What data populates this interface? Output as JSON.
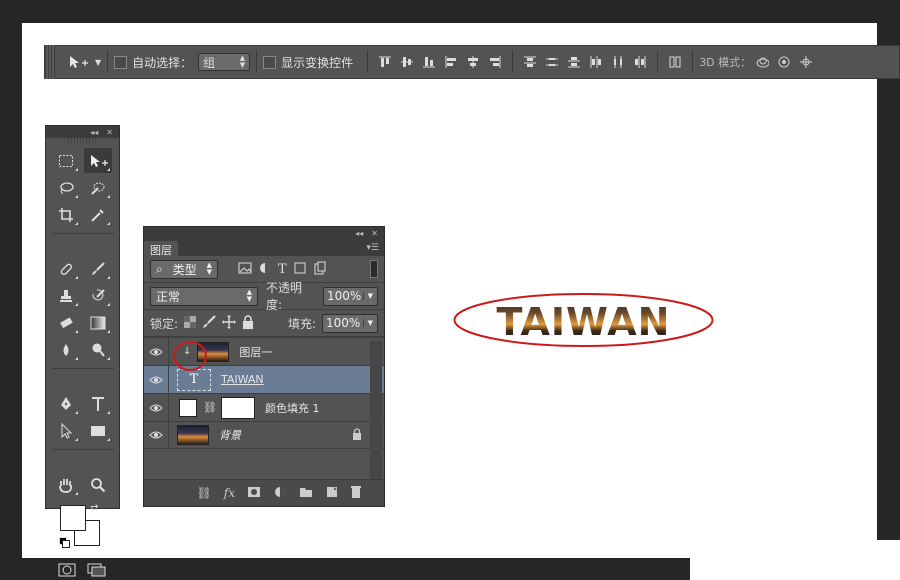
{
  "options_bar": {
    "auto_select_label": "自动选择：",
    "auto_select_value": "组",
    "show_transform_label": "显示变换控件",
    "mode_3d_label": "3D 模式："
  },
  "layers_panel": {
    "tab_label": "图层",
    "filter_label": "类型",
    "blend_mode": "正常",
    "opacity_label": "不透明度:",
    "opacity_value": "100%",
    "lock_label": "锁定:",
    "fill_label": "填充:",
    "fill_value": "100%",
    "layers": [
      {
        "name": "图层一",
        "type": "image-clipped"
      },
      {
        "name": "TAIWAN",
        "type": "text",
        "selected": true
      },
      {
        "name": "颜色填充 1",
        "type": "fill"
      },
      {
        "name": "背景",
        "type": "background",
        "locked": true
      }
    ]
  },
  "canvas": {
    "text": "TAIWAN"
  },
  "colors": {
    "annotation": "#cc1a1a",
    "selected_layer": "#6b7c95",
    "panel": "#535353"
  }
}
